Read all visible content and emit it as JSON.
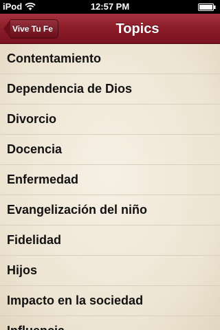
{
  "status_bar": {
    "carrier": "iPod",
    "time": "12:57 PM"
  },
  "nav": {
    "back_label": "Vive Tu Fe",
    "title": "Topics"
  },
  "topics": [
    "Contentamiento",
    "Dependencia de Dios",
    "Divorcio",
    "Docencia",
    "Enfermedad",
    "Evangelización del niño",
    "Fidelidad",
    "Hijos",
    "Impacto en la sociedad",
    "Influencia"
  ],
  "colors": {
    "nav_bar": "#8c1c29",
    "background": "#f3ece0"
  }
}
